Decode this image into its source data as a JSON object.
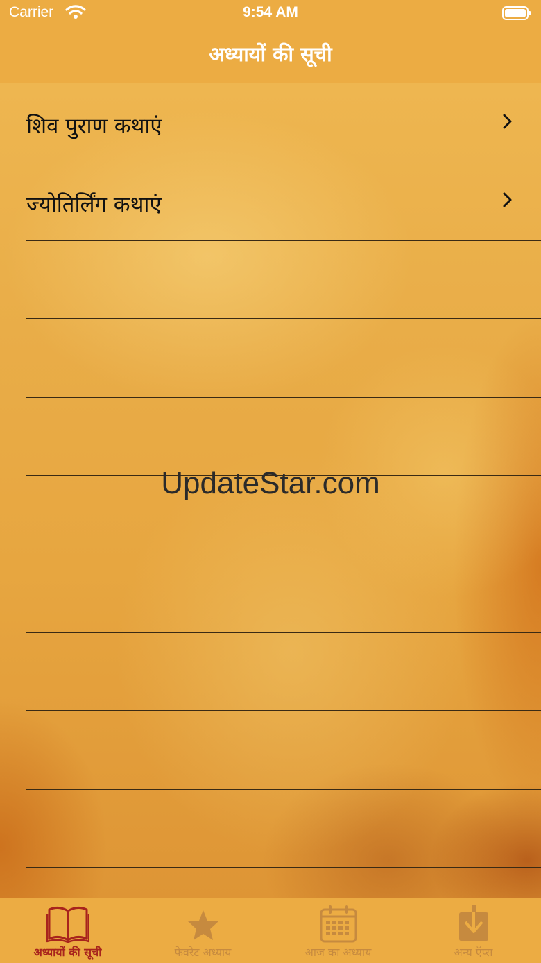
{
  "status_bar": {
    "carrier": "Carrier",
    "time": "9:54 AM"
  },
  "nav": {
    "title": "अध्यायों की सूची"
  },
  "list": {
    "items": [
      {
        "label": "शिव पुराण कथाएं"
      },
      {
        "label": "ज्योतिर्लिंग कथाएं"
      }
    ]
  },
  "watermark": "UpdateStar.com",
  "tab_bar": {
    "tabs": [
      {
        "label": "अध्यायों की सूची",
        "icon": "book-icon",
        "active": true
      },
      {
        "label": "फेवरेट अध्याय",
        "icon": "star-icon",
        "active": false
      },
      {
        "label": "आज का अध्याय",
        "icon": "calendar-icon",
        "active": false
      },
      {
        "label": "अन्य ऍप्स",
        "icon": "download-icon",
        "active": false
      }
    ]
  },
  "colors": {
    "bar_background": "#ecac43",
    "active_tab": "#a8241d",
    "inactive_tab": "#c68a3f"
  }
}
